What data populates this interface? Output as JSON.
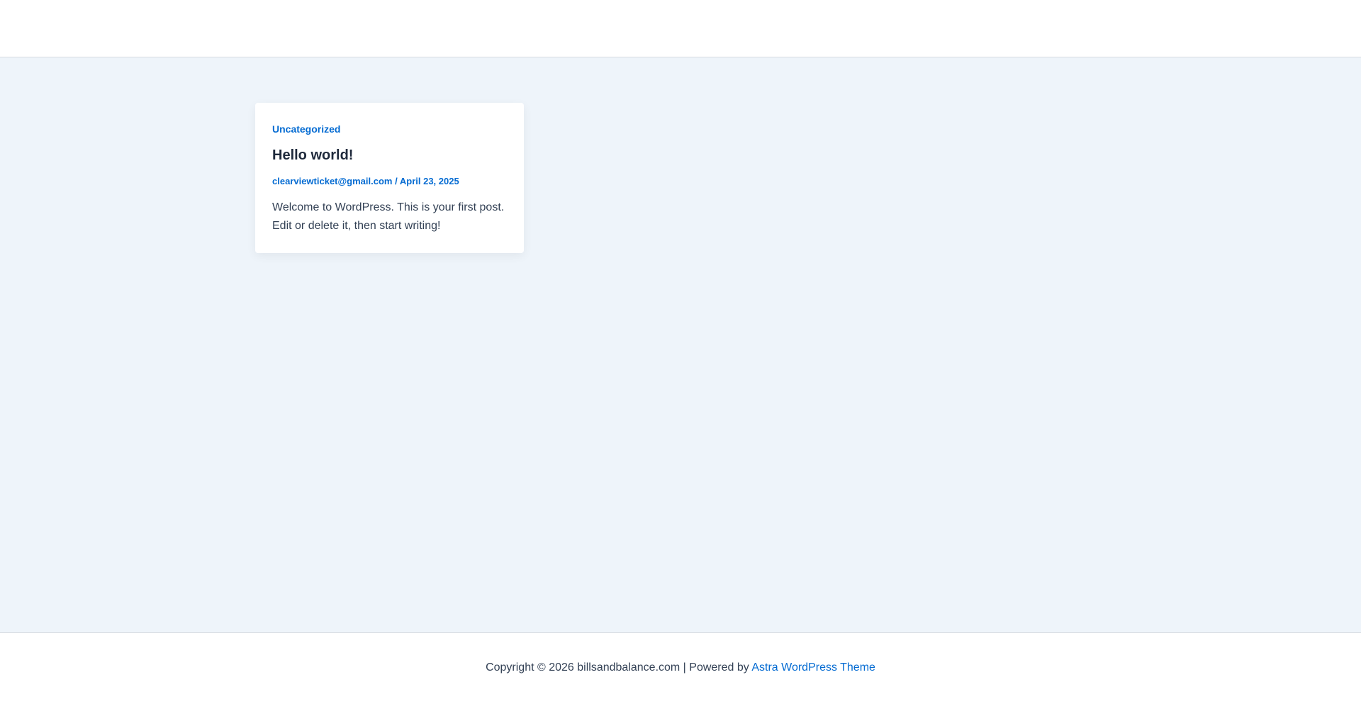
{
  "post": {
    "category": "Uncategorized",
    "title": "Hello world!",
    "author": "clearviewticket@gmail.com",
    "separator": "/",
    "date": "April 23, 2025",
    "excerpt": "Welcome to WordPress. This is your first post. Edit or delete it, then start writing!"
  },
  "footer": {
    "copyright": "Copyright © 2026 billsandbalance.com | Powered by",
    "theme_link": "Astra WordPress Theme"
  },
  "colors": {
    "accent": "#046bd2",
    "background": "#eef4fa",
    "heading": "#1e293b",
    "body_text": "#334155"
  }
}
